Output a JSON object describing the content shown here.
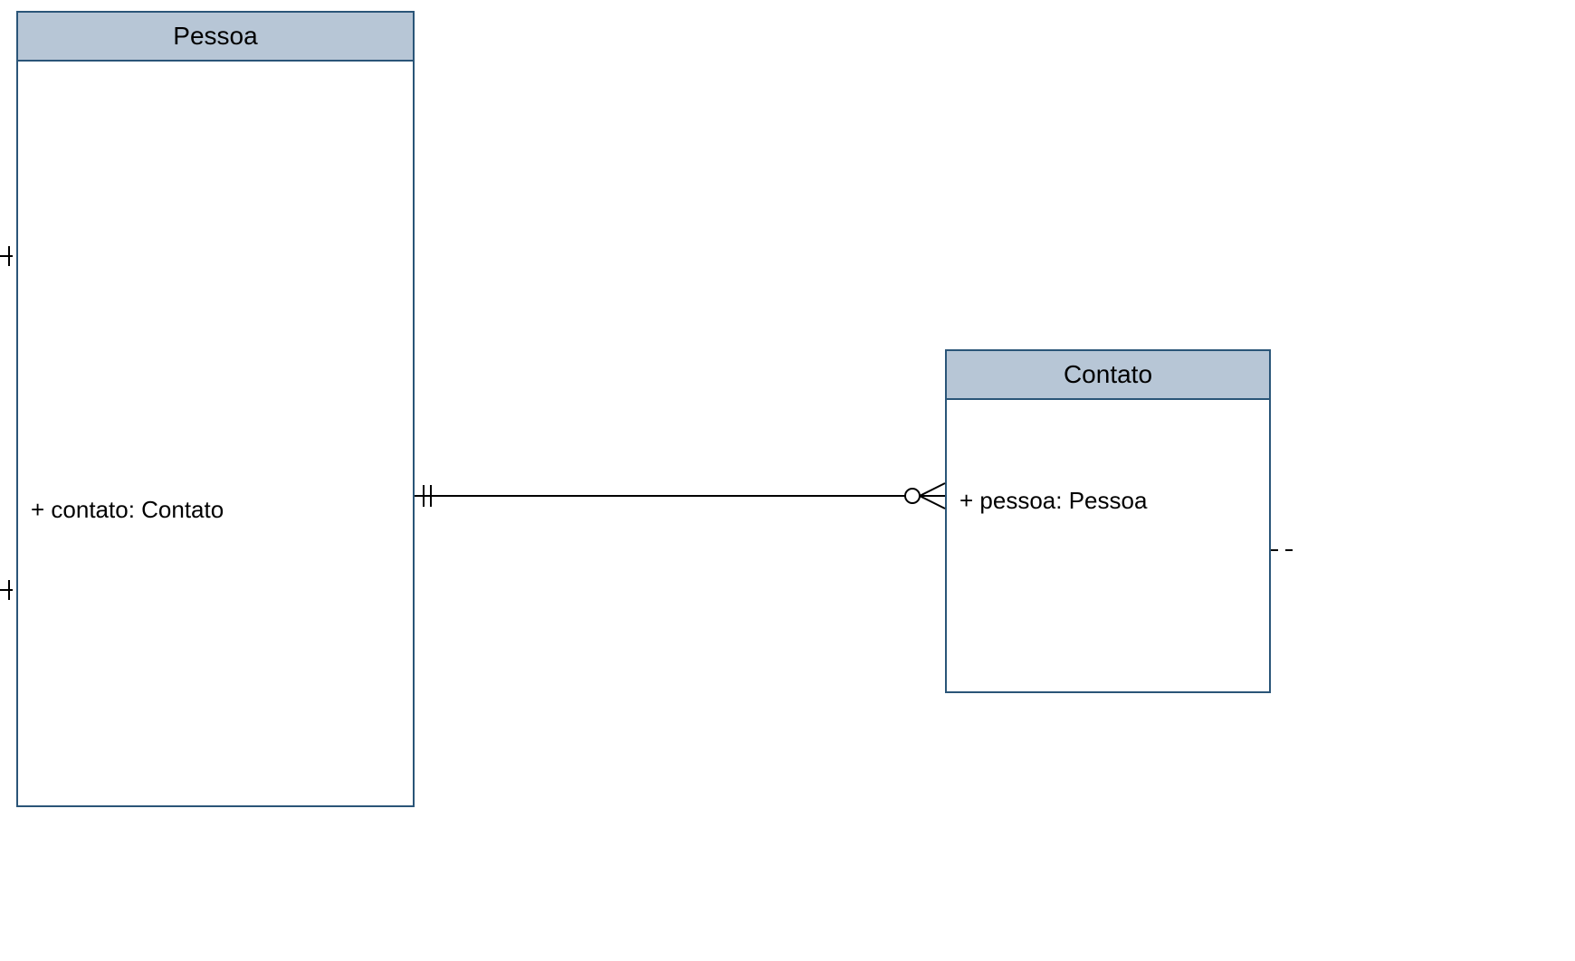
{
  "entities": {
    "pessoa": {
      "title": "Pessoa",
      "attributes": {
        "contato": "+ contato: Contato"
      }
    },
    "contato": {
      "title": "Contato",
      "attributes": {
        "pessoa": "+ pessoa: Pessoa"
      }
    }
  },
  "relationship": {
    "from": "Pessoa",
    "to": "Contato",
    "from_cardinality": "one-and-only-one",
    "to_cardinality": "zero-or-many"
  }
}
